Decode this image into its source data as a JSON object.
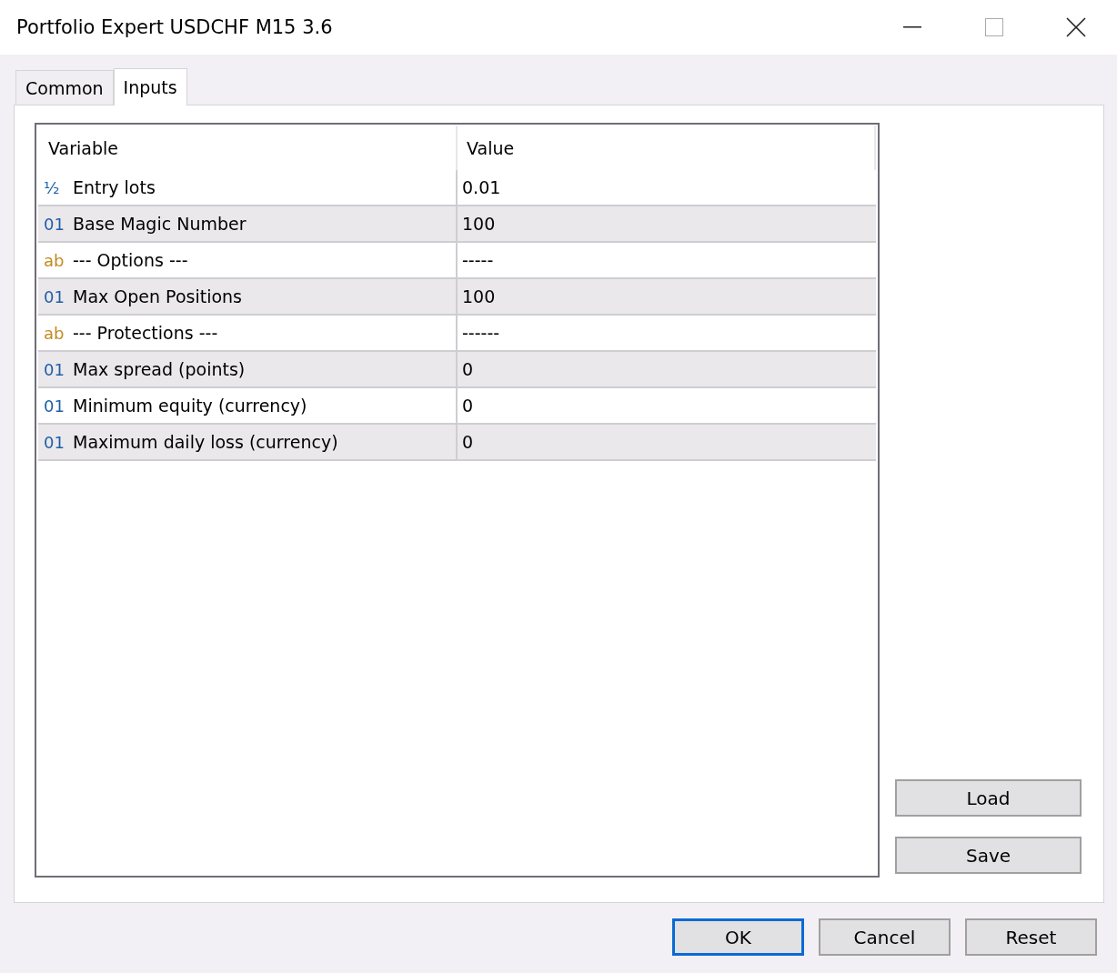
{
  "window": {
    "title": "Portfolio Expert USDCHF M15 3.6"
  },
  "tabs": [
    {
      "label": "Common",
      "selected": false
    },
    {
      "label": "Inputs",
      "selected": true
    }
  ],
  "table": {
    "columns": [
      "Variable",
      "Value"
    ],
    "rows": [
      {
        "kind": "double",
        "type_icon": "½",
        "variable": "Entry lots",
        "value": "0.01"
      },
      {
        "kind": "integer",
        "type_icon": "01",
        "variable": "Base Magic Number",
        "value": "100"
      },
      {
        "kind": "string",
        "type_icon": "ab",
        "variable": "--- Options ---",
        "value": "-----"
      },
      {
        "kind": "integer",
        "type_icon": "01",
        "variable": "Max Open Positions",
        "value": "100"
      },
      {
        "kind": "string",
        "type_icon": "ab",
        "variable": "--- Protections ---",
        "value": "------"
      },
      {
        "kind": "integer",
        "type_icon": "01",
        "variable": "Max spread (points)",
        "value": "0"
      },
      {
        "kind": "integer",
        "type_icon": "01",
        "variable": "Minimum equity (currency)",
        "value": "0"
      },
      {
        "kind": "integer",
        "type_icon": "01",
        "variable": "Maximum daily loss (currency)",
        "value": "0"
      }
    ]
  },
  "side_buttons": [
    "Load",
    "Save"
  ],
  "buttons": [
    {
      "label": "OK",
      "default": true
    },
    {
      "label": "Cancel",
      "default": false
    },
    {
      "label": "Reset",
      "default": false
    }
  ]
}
